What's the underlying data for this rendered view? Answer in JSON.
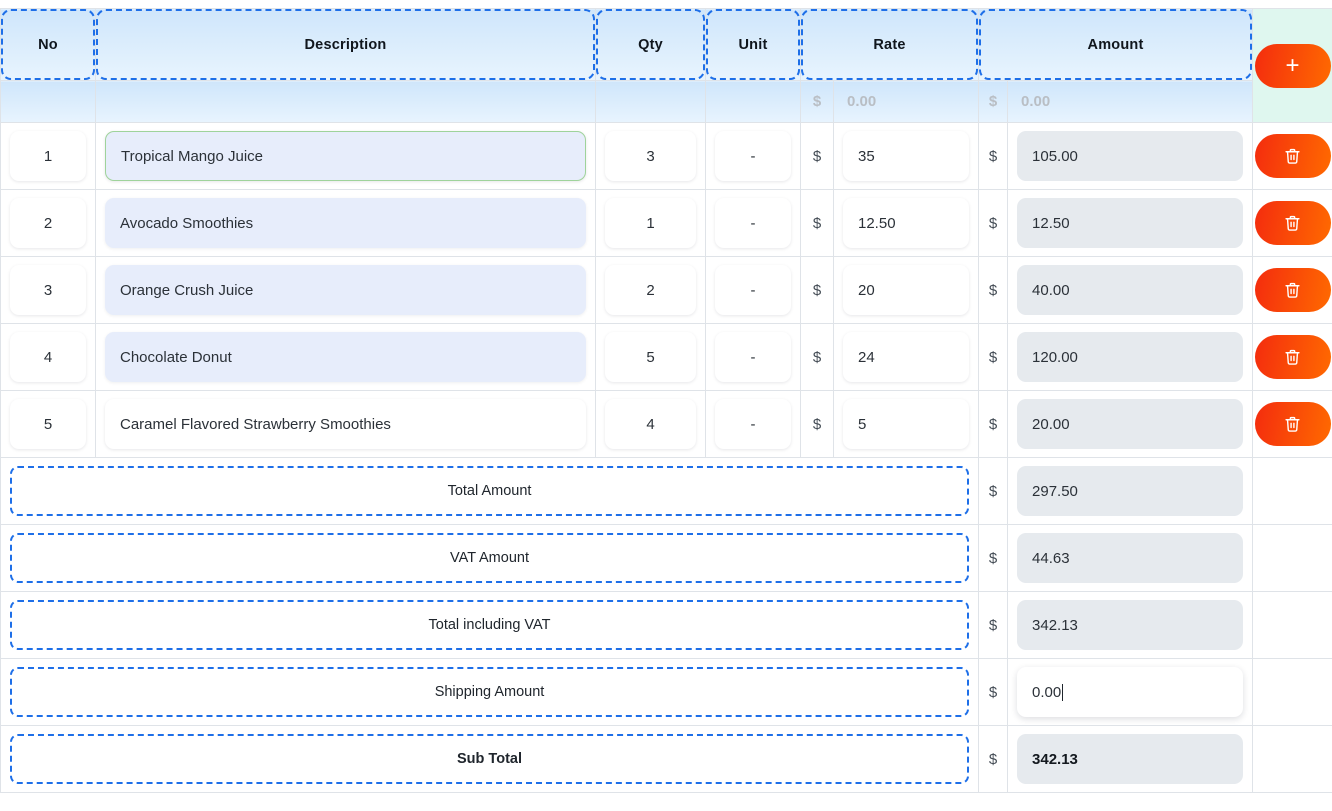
{
  "table": {
    "headers": {
      "no": "No",
      "description": "Description",
      "qty": "Qty",
      "unit": "Unit",
      "rate": "Rate",
      "amount": "Amount"
    },
    "placeholder_row": {
      "rate_currency": "$",
      "rate_placeholder": "0.00",
      "amount_currency": "$",
      "amount_placeholder": "0.00"
    },
    "add_button_label": "+",
    "currency_symbol": "$",
    "rows": [
      {
        "no": "1",
        "description": "Tropical Mango Juice",
        "qty": "3",
        "unit": "-",
        "rate_currency": "$",
        "rate": "35",
        "amount_currency": "$",
        "amount": "105.00",
        "delete_label": "Delete"
      },
      {
        "no": "2",
        "description": "Avocado Smoothies",
        "qty": "1",
        "unit": "-",
        "rate_currency": "$",
        "rate": "12.50",
        "amount_currency": "$",
        "amount": "12.50",
        "delete_label": "Delete"
      },
      {
        "no": "3",
        "description": "Orange Crush Juice",
        "qty": "2",
        "unit": "-",
        "rate_currency": "$",
        "rate": "20",
        "amount_currency": "$",
        "amount": "40.00",
        "delete_label": "Delete"
      },
      {
        "no": "4",
        "description": "Chocolate Donut",
        "qty": "5",
        "unit": "-",
        "rate_currency": "$",
        "rate": "24",
        "amount_currency": "$",
        "amount": "120.00",
        "delete_label": "Delete"
      },
      {
        "no": "5",
        "description": "Caramel Flavored Strawberry Smoothies",
        "qty": "4",
        "unit": "-",
        "rate_currency": "$",
        "rate": "5",
        "amount_currency": "$",
        "amount": "20.00",
        "delete_label": "Delete"
      }
    ],
    "summary": [
      {
        "label": "Total Amount",
        "currency": "$",
        "value": "297.50"
      },
      {
        "label": "VAT Amount",
        "currency": "$",
        "value": "44.63"
      },
      {
        "label": "Total including VAT",
        "currency": "$",
        "value": "342.13"
      },
      {
        "label": "Shipping Amount",
        "currency": "$",
        "value": "0.00"
      },
      {
        "label": "Sub Total",
        "currency": "$",
        "value": "342.13"
      }
    ]
  },
  "colors": {
    "accent_orange": "#ff6a00",
    "accent_red": "#f42c0e",
    "dashed_blue": "#1e6fe8",
    "description_fill": "#e7edfb",
    "readonly_fill": "#e6eaee",
    "header_blue": "#cfe6fb",
    "header_teal": "#dff7ef"
  }
}
